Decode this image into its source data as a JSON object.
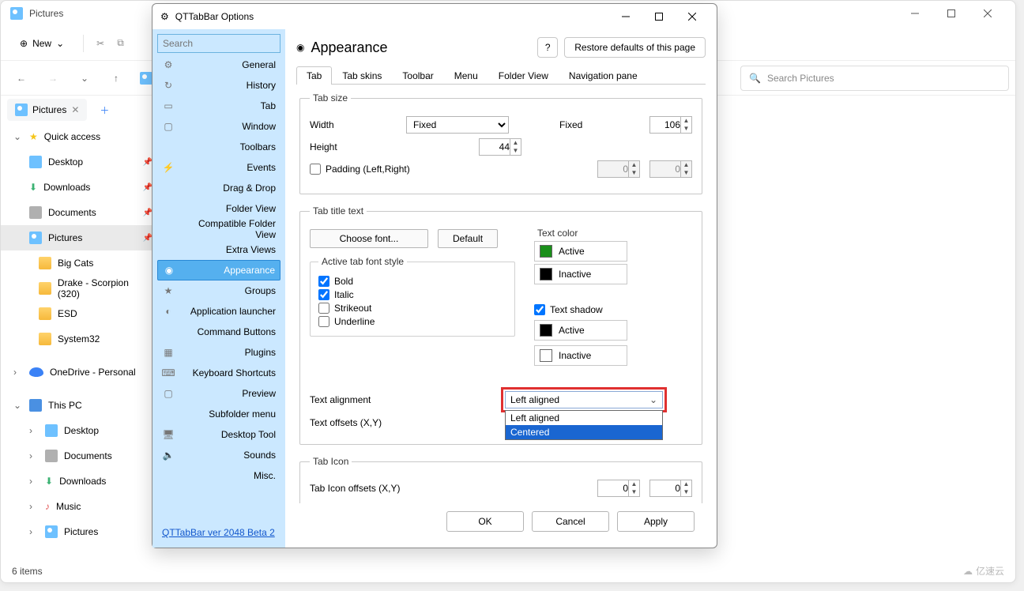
{
  "explorer": {
    "title": "Pictures",
    "new_label": "New",
    "search_placeholder": "Search Pictures",
    "tab_label": "Pictures",
    "statusbar": "6 items",
    "watermark": "亿速云",
    "quick_access_label": "Quick access",
    "tree": [
      {
        "icon": "desktop",
        "label": "Desktop",
        "pin": true,
        "indent": "sub"
      },
      {
        "icon": "download",
        "label": "Downloads",
        "pin": true,
        "indent": "sub"
      },
      {
        "icon": "document",
        "label": "Documents",
        "pin": true,
        "indent": "sub"
      },
      {
        "icon": "picture",
        "label": "Pictures",
        "pin": true,
        "indent": "sub",
        "sel": true
      },
      {
        "icon": "folder",
        "label": "Big Cats",
        "indent": "sub2"
      },
      {
        "icon": "folder",
        "label": "Drake - Scorpion (320)",
        "indent": "sub2"
      },
      {
        "icon": "folder",
        "label": "ESD",
        "indent": "sub2"
      },
      {
        "icon": "folder",
        "label": "System32",
        "indent": "sub2"
      }
    ],
    "onedrive_label": "OneDrive - Personal",
    "thispc_label": "This PC",
    "thispc": [
      {
        "icon": "desktop",
        "label": "Desktop"
      },
      {
        "icon": "document",
        "label": "Documents"
      },
      {
        "icon": "download",
        "label": "Downloads"
      },
      {
        "icon": "music",
        "label": "Music"
      },
      {
        "icon": "picture",
        "label": "Pictures"
      }
    ]
  },
  "dialog": {
    "title": "QTTabBar Options",
    "search_placeholder": "Search",
    "categories": [
      "General",
      "History",
      "Tab",
      "Window",
      "Toolbars",
      "Events",
      "Drag & Drop",
      "Folder View",
      "Compatible Folder View",
      "Extra Views",
      "Appearance",
      "Groups",
      "Application launcher",
      "Command Buttons",
      "Plugins",
      "Keyboard Shortcuts",
      "Preview",
      "Subfolder menu",
      "Desktop Tool",
      "Sounds",
      "Misc."
    ],
    "selected_category": "Appearance",
    "version": "QTTabBar ver 2048 Beta 2",
    "page_title": "Appearance",
    "restore_label": "Restore defaults of this page",
    "subtabs": [
      "Tab",
      "Tab skins",
      "Toolbar",
      "Menu",
      "Folder View",
      "Navigation pane"
    ],
    "active_subtab": "Tab",
    "tabsize_legend": "Tab size",
    "width_label": "Width",
    "width_mode": "Fixed",
    "fixed_label": "Fixed",
    "fixed_value": "106",
    "height_label": "Height",
    "height_value": "44",
    "padding_label": "Padding (Left,Right)",
    "padding_l": "0",
    "padding_r": "0",
    "title_text_legend": "Tab title text",
    "choose_font_label": "Choose font...",
    "default_label": "Default",
    "active_font_style_legend": "Active tab font style",
    "styles": {
      "bold": "Bold",
      "italic": "Italic",
      "strikeout": "Strikeout",
      "underline": "Underline"
    },
    "textcolor_legend": "Text color",
    "active_label": "Active",
    "inactive_label": "Inactive",
    "shadow_label": "Text shadow",
    "alignment_label": "Text alignment",
    "alignment_value": "Left aligned",
    "alignment_options": [
      "Left aligned",
      "Centered"
    ],
    "offsets_label": "Text offsets (X,Y)",
    "tabicon_legend": "Tab Icon",
    "tabicon_offsets_label": "Tab Icon offsets (X,Y)",
    "tabicon_x": "0",
    "tabicon_y": "0",
    "ok_label": "OK",
    "cancel_label": "Cancel",
    "apply_label": "Apply"
  }
}
